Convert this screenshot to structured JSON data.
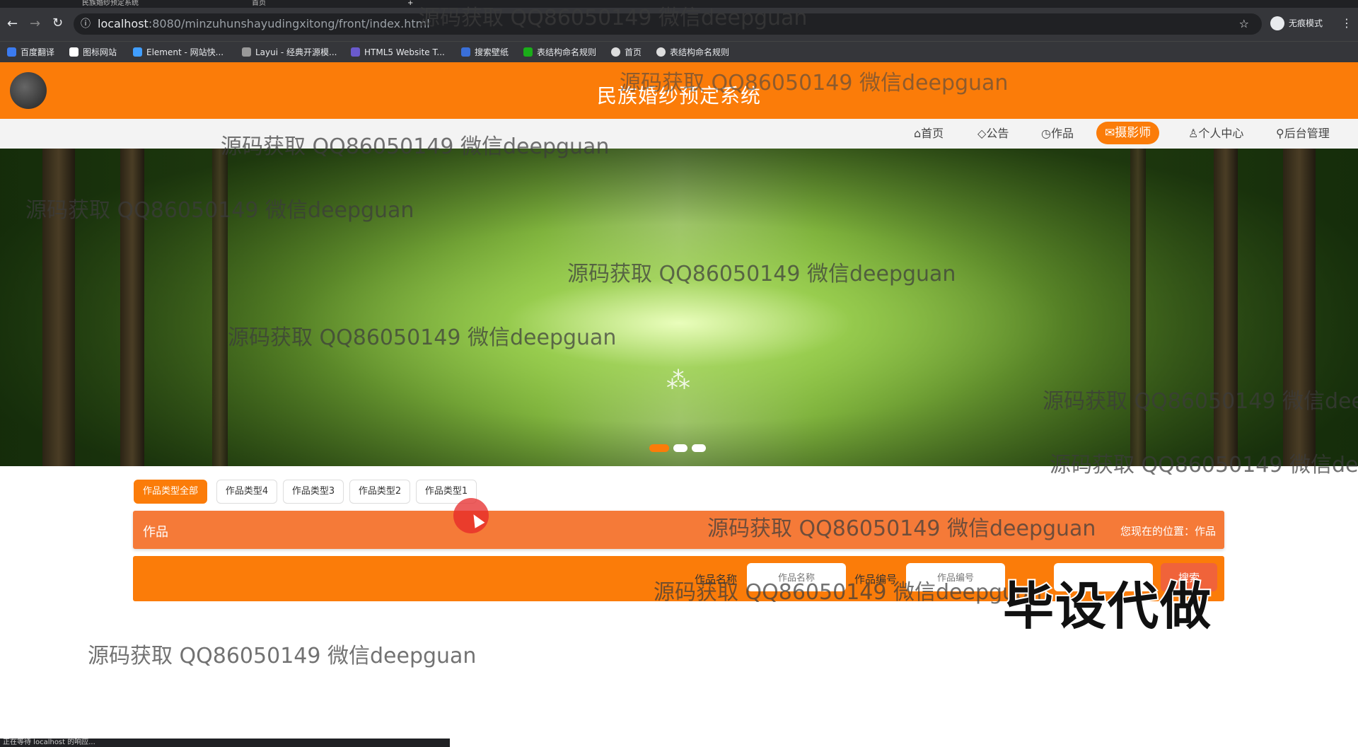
{
  "browser": {
    "tabs": [
      {
        "label": "民族婚纱预定系统"
      },
      {
        "label": "首页"
      }
    ],
    "new_tab_glyph": "+",
    "url_host": "localhost",
    "url_path": ":8080/minzuhunshayudingxitong/front/index.html",
    "mode_label": "无痕模式",
    "bookmarks": [
      {
        "label": "百度翻译",
        "color": "#3b7bf0"
      },
      {
        "label": "图标网站",
        "color": "#ffffff"
      },
      {
        "label": "Element - 网站快...",
        "color": "#409eff"
      },
      {
        "label": "Layui - 经典开源模...",
        "color": "#999999"
      },
      {
        "label": "HTML5 Website T...",
        "color": "#6a5acd"
      },
      {
        "label": "搜索壁纸",
        "color": "#3a6fd8"
      },
      {
        "label": "表结构命名规则",
        "color": "#1aad19"
      },
      {
        "label": "首页",
        "color": "#dddddd"
      },
      {
        "label": "表结构命名规则",
        "color": "#dddddd"
      }
    ],
    "status_text": "正在等待 localhost 的响应..."
  },
  "header": {
    "title": "民族婚纱预定系统",
    "bg_color": "#fb7c09"
  },
  "nav": {
    "items": [
      {
        "label": "首页",
        "icon": "home-icon"
      },
      {
        "label": "公告",
        "icon": "tag-icon"
      },
      {
        "label": "作品",
        "icon": "clock-icon"
      },
      {
        "label": "摄影师",
        "icon": "mail-icon",
        "active": true
      },
      {
        "label": "个人中心",
        "icon": "user-icon"
      },
      {
        "label": "后台管理",
        "icon": "link-icon"
      }
    ],
    "icons": {
      "home": "⌂",
      "tag": "◇",
      "clock": "◷",
      "mail": "✉",
      "user": "♙",
      "link": "⚲"
    }
  },
  "banner": {
    "slide_count": 3,
    "active_slide": 1,
    "loading_glyph": "⁂"
  },
  "categories": [
    {
      "label": "作品类型全部",
      "active": true
    },
    {
      "label": "作品类型4"
    },
    {
      "label": "作品类型3"
    },
    {
      "label": "作品类型2"
    },
    {
      "label": "作品类型1"
    }
  ],
  "section": {
    "title": "作品",
    "breadcrumb": "您现在的位置：作品"
  },
  "search": {
    "name_label": "作品名称",
    "name_placeholder": "作品名称",
    "code_label": "作品编号",
    "code_placeholder": "作品编号",
    "button_label": "搜索"
  },
  "watermarks": {
    "text": "源码获取 QQ86050149 微信deepguan",
    "stamp": "毕设代做"
  }
}
